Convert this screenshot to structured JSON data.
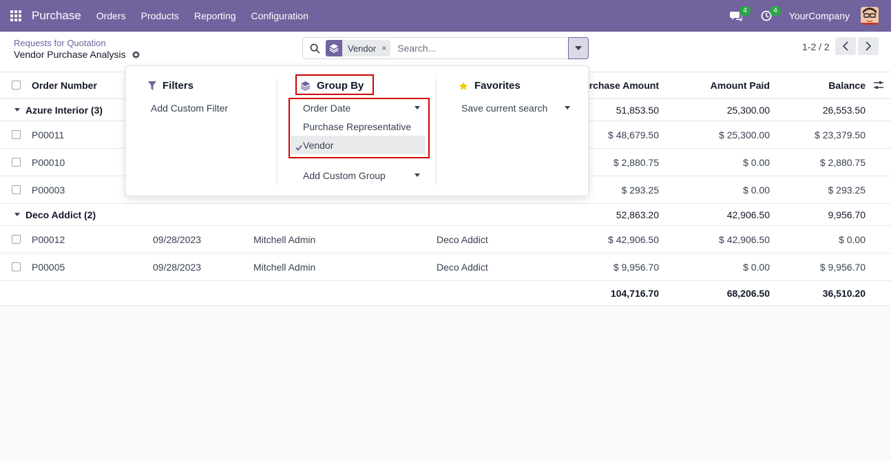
{
  "navbar": {
    "app_name": "Purchase",
    "menu": [
      "Orders",
      "Products",
      "Reporting",
      "Configuration"
    ],
    "messages_badge": "4",
    "activities_badge": "4",
    "company": "YourCompany"
  },
  "control_panel": {
    "breadcrumb": "Requests for Quotation",
    "title": "Vendor Purchase Analysis",
    "search": {
      "facet_label": "Vendor",
      "facet_remove": "×",
      "placeholder": "Search..."
    },
    "pager": "1-2 / 2"
  },
  "table": {
    "columns": [
      "Order Number",
      "urchase Amount",
      "Amount Paid",
      "Balance"
    ],
    "groups": [
      {
        "label": "Azure Interior (3)",
        "totals": [
          "51,853.50",
          "25,300.00",
          "26,553.50"
        ],
        "rows": [
          {
            "order": "P00011",
            "date": "",
            "rep": "",
            "vendor": "",
            "amount": "$ 48,679.50",
            "paid": "$ 25,300.00",
            "balance": "$ 23,379.50"
          },
          {
            "order": "P00010",
            "date": "",
            "rep": "",
            "vendor": "",
            "amount": "$ 2,880.75",
            "paid": "$ 0.00",
            "balance": "$ 2,880.75"
          },
          {
            "order": "P00003",
            "date": "",
            "rep": "",
            "vendor": "",
            "amount": "$ 293.25",
            "paid": "$ 0.00",
            "balance": "$ 293.25"
          }
        ]
      },
      {
        "label": "Deco Addict (2)",
        "totals": [
          "52,863.20",
          "42,906.50",
          "9,956.70"
        ],
        "rows": [
          {
            "order": "P00012",
            "date": "09/28/2023",
            "rep": "Mitchell Admin",
            "vendor": "Deco Addict",
            "amount": "$ 42,906.50",
            "paid": "$ 42,906.50",
            "balance": "$ 0.00"
          },
          {
            "order": "P00005",
            "date": "09/28/2023",
            "rep": "Mitchell Admin",
            "vendor": "Deco Addict",
            "amount": "$ 9,956.70",
            "paid": "$ 0.00",
            "balance": "$ 9,956.70"
          }
        ]
      }
    ],
    "grand_totals": [
      "104,716.70",
      "68,206.50",
      "36,510.20"
    ]
  },
  "dropdown": {
    "filters": {
      "header": "Filters",
      "items": [
        "Add Custom Filter"
      ]
    },
    "group_by": {
      "header": "Group By",
      "items": [
        "Order Date",
        "Purchase Representative",
        "Vendor"
      ],
      "selected": "Vendor",
      "custom": "Add Custom Group"
    },
    "favorites": {
      "header": "Favorites",
      "items": [
        "Save current search"
      ]
    }
  },
  "colors": {
    "brand": "#71639e",
    "highlight": "#d10000",
    "badge": "#28a745"
  }
}
